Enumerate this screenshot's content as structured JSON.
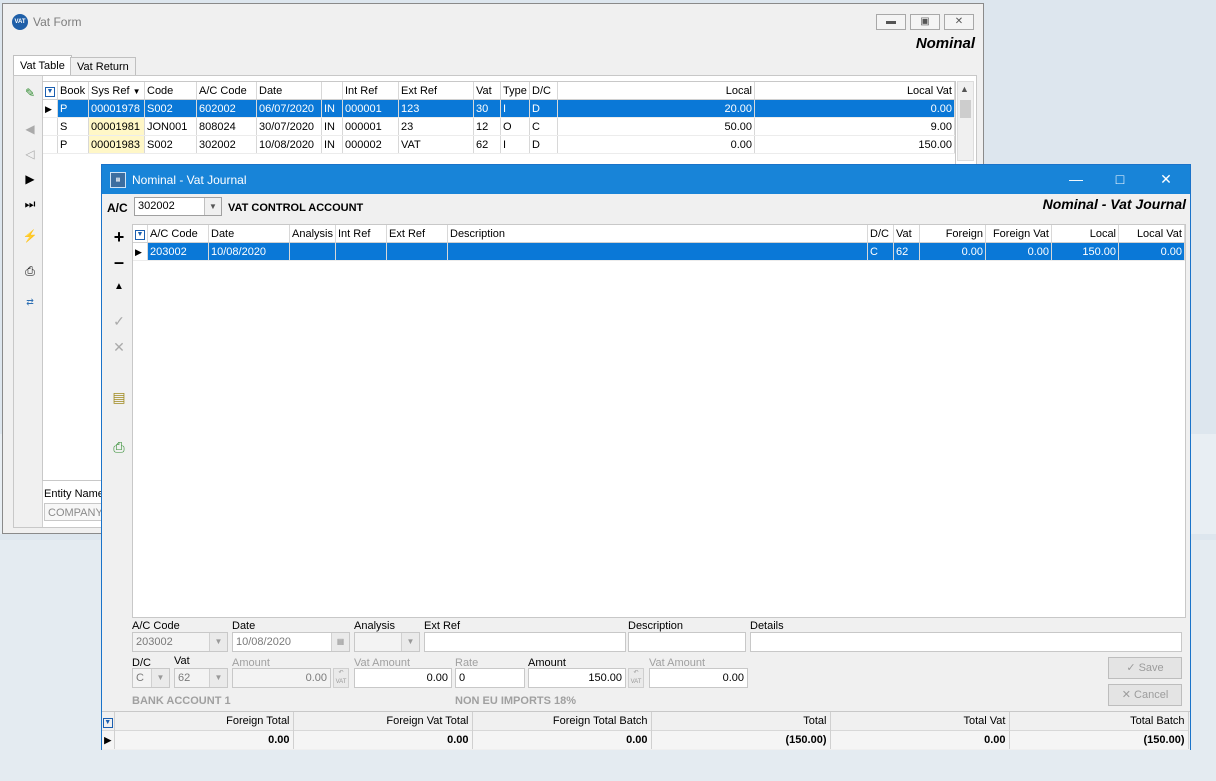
{
  "vat_form": {
    "title": "Vat Form",
    "heading": "Nominal",
    "tabs": [
      "Vat Table",
      "Vat Return"
    ],
    "columns": [
      "Book",
      "Sys Ref",
      "Code",
      "A/C Code",
      "Date",
      "",
      "Int Ref",
      "Ext Ref",
      "Vat",
      "Type",
      "D/C",
      "Local",
      "Local Vat"
    ],
    "rows": [
      [
        "P",
        "00001978",
        "S002",
        "602002",
        "06/07/2020",
        "IN",
        "000001",
        "123",
        "30",
        "I",
        "D",
        "20.00",
        "0.00"
      ],
      [
        "S",
        "00001981",
        "JON001",
        "808024",
        "30/07/2020",
        "IN",
        "000001",
        "23",
        "12",
        "O",
        "C",
        "50.00",
        "9.00"
      ],
      [
        "P",
        "00001983",
        "S002",
        "302002",
        "10/08/2020",
        "IN",
        "000002",
        "VAT",
        "62",
        "I",
        "D",
        "0.00",
        "150.00"
      ]
    ],
    "entity_label": "Entity Name",
    "entity_value": "COMPANY L"
  },
  "vat_journal": {
    "title": "Nominal - Vat Journal",
    "heading": "Nominal - Vat Journal",
    "ac_label": "A/C",
    "ac_code": "302002",
    "ac_name": "VAT CONTROL ACCOUNT",
    "columns": [
      "A/C Code",
      "Date",
      "Analysis",
      "Int Ref",
      "Ext Ref",
      "Description",
      "D/C",
      "Vat",
      "Foreign",
      "Foreign Vat",
      "Local",
      "Local Vat"
    ],
    "rows": [
      [
        "203002",
        "10/08/2020",
        "",
        "",
        "",
        "",
        "C",
        "62",
        "0.00",
        "0.00",
        "150.00",
        "0.00"
      ]
    ],
    "form": {
      "ac_code_label": "A/C Code",
      "ac_code_value": "203002",
      "date_label": "Date",
      "date_value": "10/08/2020",
      "analysis_label": "Analysis",
      "ext_ref_label": "Ext Ref",
      "description_label": "Description",
      "details_label": "Details",
      "dc_label": "D/C",
      "dc_value": "C",
      "vat_label": "Vat",
      "vat_value": "62",
      "amount_label": "Amount",
      "amount_value": "0.00",
      "vat_amount_label": "Vat Amount",
      "vat_amount_value": "0.00",
      "rate_label": "Rate",
      "rate_value": "0",
      "amount2_label": "Amount",
      "amount2_value": "150.00",
      "vat_amount2_label": "Vat Amount",
      "vat_amount2_value": "0.00",
      "account_name": "BANK ACCOUNT 1",
      "vat_code_name": "NON EU IMPORTS 18%",
      "vat_icon_text": "VAT",
      "save_label": "Save",
      "cancel_label": "Cancel"
    },
    "totals": {
      "headers": [
        "Foreign Total",
        "Foreign Vat Total",
        "Foreign Total Batch",
        "Total",
        "Total Vat",
        "Total Batch"
      ],
      "values": [
        "0.00",
        "0.00",
        "0.00",
        "(150.00)",
        "0.00",
        "(150.00)"
      ]
    }
  }
}
